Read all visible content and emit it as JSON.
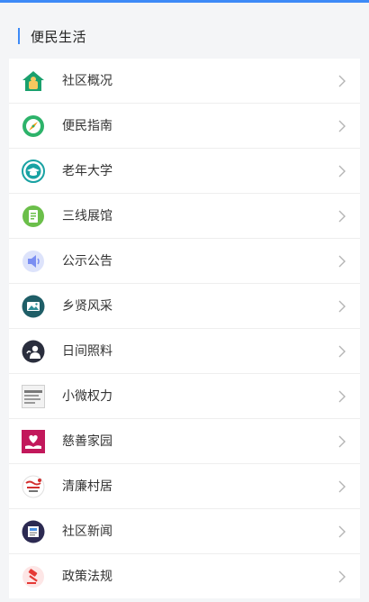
{
  "section": {
    "title": "便民生活"
  },
  "items": [
    {
      "label": "社区概况",
      "icon": "home-icon"
    },
    {
      "label": "便民指南",
      "icon": "compass-icon"
    },
    {
      "label": "老年大学",
      "icon": "graduation-cap-icon"
    },
    {
      "label": "三线展馆",
      "icon": "book-icon"
    },
    {
      "label": "公示公告",
      "icon": "speaker-icon"
    },
    {
      "label": "乡贤风采",
      "icon": "photo-icon"
    },
    {
      "label": "日间照料",
      "icon": "caregiver-icon"
    },
    {
      "label": "小微权力",
      "icon": "power-list-icon"
    },
    {
      "label": "慈善家园",
      "icon": "heart-hand-icon"
    },
    {
      "label": "清廉村居",
      "icon": "integrity-seal-icon"
    },
    {
      "label": "社区新闻",
      "icon": "news-icon"
    },
    {
      "label": "政策法规",
      "icon": "gavel-icon"
    }
  ],
  "colors": {
    "accent": "#3d8af7",
    "home": "#1aa06d",
    "compass": "#2db36a",
    "graduation": "#19a2a3",
    "book": "#6bbf4a",
    "speaker": "#7a8ef2",
    "photo": "#1f5e67",
    "caregiver": "#2a2e3d",
    "heart": "#c2185b",
    "integrity": "#d32f2f",
    "news": "#2c2a52",
    "gavel": "#e53935"
  }
}
